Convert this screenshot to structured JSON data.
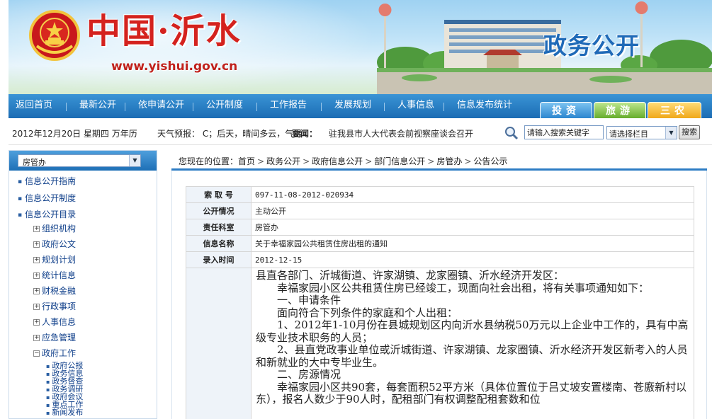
{
  "header": {
    "site_title": "中国·沂水",
    "site_url": "www.yishui.gov.cn",
    "section_title": "政务公开"
  },
  "nav": {
    "items": [
      "返回首页",
      "最新公开",
      "依申请公开",
      "公开制度",
      "工作报告",
      "发展规划",
      "人事信息",
      "信息发布统计"
    ],
    "tabs": [
      "投资",
      "旅游",
      "三农"
    ]
  },
  "infobar": {
    "date": "2012年12月20日  星期四  万年历",
    "weather": "天气预报：  C；后天，晴间多云，气温",
    "news_label": "要闻：",
    "news_text": "驻我县市人大代表会前视察座谈会召开",
    "search_placeholder": "请输入搜索关键字",
    "search_select": "请选择栏目",
    "search_button": "搜索"
  },
  "sidebar": {
    "dept_select": "房管办",
    "top_items": [
      "信息公开指南",
      "信息公开制度",
      "信息公开目录"
    ],
    "sub_items": [
      {
        "sign": "+",
        "label": "组织机构"
      },
      {
        "sign": "+",
        "label": "政府公文"
      },
      {
        "sign": "+",
        "label": "规划计划"
      },
      {
        "sign": "+",
        "label": "统计信息"
      },
      {
        "sign": "+",
        "label": "财税金融"
      },
      {
        "sign": "+",
        "label": "行政事项"
      },
      {
        "sign": "+",
        "label": "人事信息"
      },
      {
        "sign": "+",
        "label": "应急管理"
      },
      {
        "sign": "−",
        "label": "政府工作"
      }
    ],
    "leaf_items": [
      "政府公报",
      "政务信息",
      "政务督查",
      "政务调研",
      "政府会议",
      "重点工作",
      "新闻发布"
    ]
  },
  "breadcrumb": {
    "prefix": "您现在的位置：",
    "crumbs": [
      "首页",
      "政务公开",
      "政府信息公开",
      "部门信息公开",
      "房管办",
      "公告公示"
    ]
  },
  "meta": [
    {
      "key": "索 取 号",
      "value": "097-11-08-2012-020934"
    },
    {
      "key": "公开情况",
      "value": "主动公开"
    },
    {
      "key": "责任科室",
      "value": "房管办"
    },
    {
      "key": "信息名称",
      "value": "关于幸福家园公共租赁住房出租的通知"
    },
    {
      "key": "录入时间",
      "value": "2012-12-15"
    }
  ],
  "content": {
    "lines": [
      "县直各部门、沂城街道、许家湖镇、龙家圈镇、沂水经济开发区：",
      "幸福家园小区公共租赁住房已经竣工，现面向社会出租，将有关事项通知如下：",
      "一、申请条件",
      "面向符合下列条件的家庭和个人出租：",
      "1、2012年1-10月份在县城规划区内向沂水县纳税50万元以上企业中工作的，具有中高级专业技术职务的人员；",
      "2、县直党政事业单位或沂城街道、许家湖镇、龙家圈镇、沂水经济开发区新考入的人员和新就业的大中专毕业生。",
      "二、房源情况",
      "幸福家园小区共90套，每套面积52平方米（具体位置位于吕丈坡安置楼南、苍廒新村以东），报名人数少于90人时，配租部门有权调整配租套数和位"
    ]
  }
}
